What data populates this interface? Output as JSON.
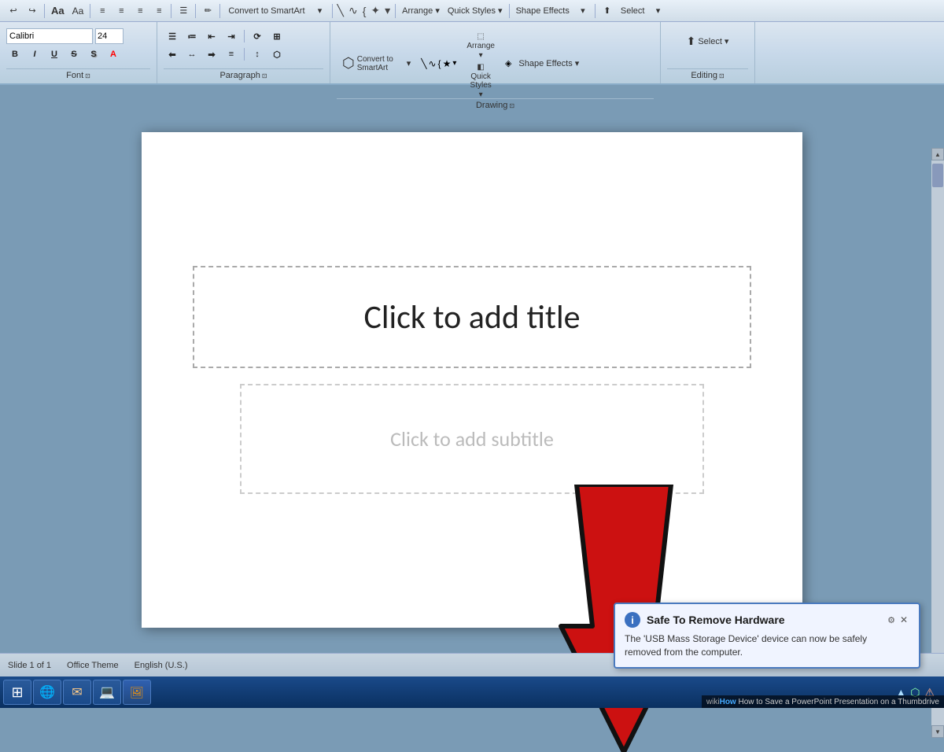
{
  "ribbon": {
    "sections": {
      "font": {
        "label": "Font",
        "font_name": "Calibri",
        "font_size": "24",
        "bold": "B",
        "italic": "I",
        "underline": "U"
      },
      "paragraph": {
        "label": "Paragraph"
      },
      "drawing": {
        "label": "Drawing",
        "convert_smartart": "Convert to SmartArt",
        "arrange": "Arrange",
        "quick_styles": "Quick\nStyles",
        "shape_effects": "Shape Effects",
        "dropdown_arrow": "▾"
      },
      "editing": {
        "label": "Editing",
        "select": "Select",
        "dropdown_arrow": "▾"
      }
    }
  },
  "slide": {
    "title_placeholder": "Click to add title",
    "subtitle_placeholder": "Click to add subtitle"
  },
  "notification": {
    "title": "Safe To Remove Hardware",
    "body": "The 'USB Mass Storage Device' device can now be safely\nremoved from the computer.",
    "icon": "i"
  },
  "status_bar": {
    "slide_info": "Slide 1 of 1",
    "theme": "Office Theme",
    "lang": "English (U.S.)"
  },
  "wiki_watermark": {
    "prefix": "wiki",
    "text": "How to Save a PowerPoint Presentation on a Thumbdrive"
  },
  "taskbar": {
    "start_label": "⊞",
    "icons": [
      "⊞",
      "🌐",
      "✉",
      "💻",
      "🖼"
    ]
  }
}
